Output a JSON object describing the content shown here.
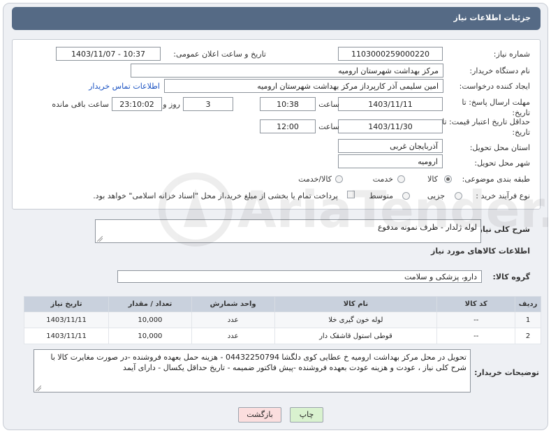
{
  "header": {
    "title": "جزئیات اطلاعات نیاز"
  },
  "fields": {
    "need_number_label": "شماره نیاز:",
    "need_number": "1103000259000220",
    "announce_label": "تاریخ و ساعت اعلان عمومی:",
    "announce_value": "1403/11/07 - 10:37",
    "buyer_org_label": "نام دستگاه خریدار:",
    "buyer_org": "مرکز بهداشت شهرستان ارومیه",
    "creator_label": "ایجاد کننده درخواست:",
    "creator": "امین سلیمی آذر کارپرداز مرکز بهداشت شهرستان ارومیه",
    "contact_link": "اطلاعات تماس خریدار",
    "reply_deadline_label": "مهلت ارسال پاسخ: تا تاریخ:",
    "reply_date": "1403/11/11",
    "time_label": "ساعت",
    "reply_time": "10:38",
    "days_value": "3",
    "days_label": "روز و",
    "remaining_time": "23:10:02",
    "remaining_label": "ساعت باقی مانده",
    "validity_label": "حداقل تاریخ اعتبار قیمت: تا تاریخ:",
    "validity_date": "1403/11/30",
    "validity_time": "12:00",
    "province_label": "استان محل تحویل:",
    "province": "آذربایجان غربی",
    "city_label": "شهر محل تحویل:",
    "city": "ارومیه",
    "category_label": "طبقه بندی موضوعی:",
    "category_options": [
      "کالا",
      "خدمت",
      "کالا/خدمت"
    ],
    "process_label": "نوع فرآیند خرید :",
    "process_options": [
      "جزیی",
      "متوسط"
    ],
    "payment_note": "پرداخت تمام یا بخشی از مبلغ خرید،از محل \"اسناد خزانه اسلامی\" خواهد بود."
  },
  "description": {
    "label": "شرح کلی نیاز:",
    "value": "لوله ژلدار - ظرف نمونه مدفوع"
  },
  "goods": {
    "section_title": "اطلاعات کالاهای مورد نیاز",
    "group_label": "گروه کالا:",
    "group_value": "دارو، پزشکی و سلامت",
    "columns": [
      "ردیف",
      "کد کالا",
      "نام کالا",
      "واحد شمارش",
      "تعداد / مقدار",
      "تاریخ نیاز"
    ],
    "rows": [
      {
        "idx": "1",
        "code": "--",
        "name": "لوله خون گیری خلا",
        "unit": "عدد",
        "qty": "10,000",
        "date": "1403/11/11"
      },
      {
        "idx": "2",
        "code": "--",
        "name": "قوطی استول قاشقک دار",
        "unit": "عدد",
        "qty": "10,000",
        "date": "1403/11/11"
      }
    ]
  },
  "buyer_notes": {
    "label": "توضیحات خریدار:",
    "value": "تحویل در محل مرکز بهداشت ارومیه خ عطایی کوی دلگشا 04432250794 - هزینه حمل بعهده فروشنده -در صورت مغایرت کالا با شرح کلی نیاز ، عودت و هزینه عودت بعهده فروشنده -پیش فاکتور  ضمیمه - تاریخ حداقل یکسال - دارای آیمد"
  },
  "buttons": {
    "print": "چاپ",
    "back": "بازگشت"
  },
  "colors": {
    "header_bg": "#556a85",
    "grid_header": "#c9d1dd",
    "print_btn": "#d9f2cf",
    "back_btn": "#fbdede",
    "link": "#1a52c2"
  },
  "watermark_text": "AriaTender.neT"
}
